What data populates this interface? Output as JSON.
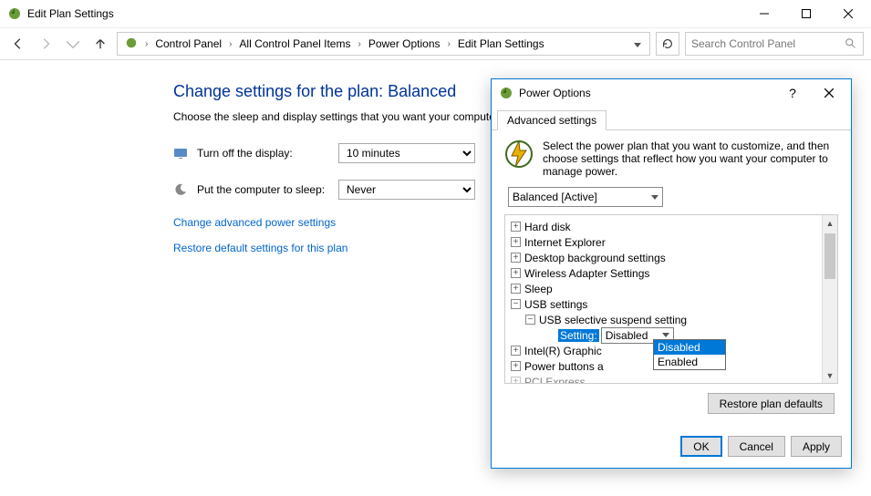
{
  "window": {
    "title": "Edit Plan Settings"
  },
  "breadcrumb": {
    "items": [
      "Control Panel",
      "All Control Panel Items",
      "Power Options",
      "Edit Plan Settings"
    ]
  },
  "search": {
    "placeholder": "Search Control Panel"
  },
  "page": {
    "heading": "Change settings for the plan: Balanced",
    "description": "Choose the sleep and display settings that you want your computer to use.",
    "rows": {
      "display": {
        "label": "Turn off the display:",
        "value": "10 minutes"
      },
      "sleep": {
        "label": "Put the computer to sleep:",
        "value": "Never"
      }
    },
    "link_advanced": "Change advanced power settings",
    "link_restore": "Restore default settings for this plan"
  },
  "dialog": {
    "title": "Power Options",
    "tab": "Advanced settings",
    "intro": "Select the power plan that you want to customize, and then choose settings that reflect how you want your computer to manage power.",
    "plan": "Balanced [Active]",
    "tree": {
      "hard_disk": "Hard disk",
      "ie": "Internet Explorer",
      "desktop_bg": "Desktop background settings",
      "wireless": "Wireless Adapter Settings",
      "sleep": "Sleep",
      "usb": "USB settings",
      "usb_sel": "USB selective suspend setting",
      "setting_label": "Setting:",
      "setting_value": "Disabled",
      "graphics": "Intel(R) Graphic",
      "power_btns": "Power buttons a",
      "pci": "PCI Express"
    },
    "dropdown": {
      "opt1": "Disabled",
      "opt2": "Enabled"
    },
    "restore_btn": "Restore plan defaults",
    "ok": "OK",
    "cancel": "Cancel",
    "apply": "Apply"
  }
}
